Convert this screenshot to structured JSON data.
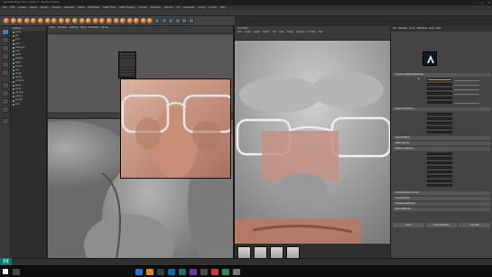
{
  "window": {
    "title": "Autodesk Maya 2017 Update 3 - Student Version",
    "controls": [
      "—",
      "▢",
      "✕"
    ]
  },
  "menus": [
    "File",
    "Edit",
    "Create",
    "Select",
    "Modify",
    "Display",
    "Windows",
    "Mesh",
    "Edit Mesh",
    "Mesh Tools",
    "Mesh Display",
    "Curves",
    "Surfaces",
    "Deform",
    "UV",
    "Generate",
    "Cache",
    "Arnold",
    "Help"
  ],
  "outliner": {
    "title": "Outliner",
    "items": [
      "persp",
      "top",
      "front",
      "side",
      "head_geo",
      "eyeL",
      "eyeR",
      "glasses",
      "teeth",
      "tongue",
      "hair",
      "brows",
      "lashes",
      "camera1",
      "light1",
      "light2",
      "ref_img",
      "group1",
      "group2",
      "set1"
    ]
  },
  "viewport_top": {
    "menus": [
      "View",
      "Shading",
      "Lighting",
      "Show",
      "Renderer",
      "Panels"
    ]
  },
  "uv_editor": {
    "title": "UV Editor",
    "menus": [
      "Edit",
      "Create",
      "Select",
      "Modify",
      "Tool",
      "View",
      "Image",
      "Textures",
      "UV Sets",
      "Help"
    ]
  },
  "attribute_editor": {
    "tabs": [
      "List",
      "Selected",
      "Focus",
      "Attributes",
      "Show",
      "Help"
    ],
    "sections": [
      "Common Material Attributes",
      "Specular Shading",
      "Special Effects",
      "Matte Opacity",
      "Raytrace Options",
      "Vector Renderer Control",
      "Node Behavior",
      "Hardware Texturing",
      "Extra Attributes"
    ],
    "buttons": [
      "Select",
      "Load Attributes",
      "Copy Tab"
    ]
  },
  "colors": {
    "accent": "#4d7fb2",
    "maya_logo": "#5ee3d6",
    "skin": "#c89482"
  },
  "icons": [
    "select-tool-icon",
    "move-tool-icon",
    "rotate-tool-icon",
    "scale-tool-icon",
    "windows-start-icon",
    "search-icon",
    "maya-logo-icon"
  ]
}
